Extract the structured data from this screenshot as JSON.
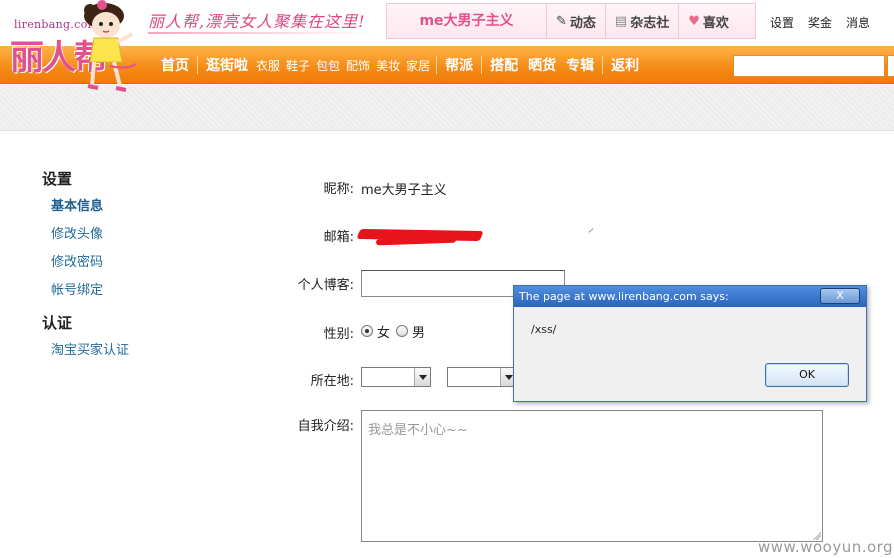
{
  "header": {
    "logo_url": "lirenbang.com",
    "logo_text": "丽人帮",
    "slogan": "丽人帮,漂亮女人聚集在这里!",
    "user_name": "me大男子主义",
    "user_links": [
      {
        "icon": "pencil-icon",
        "label": "动态"
      },
      {
        "icon": "magazine-icon",
        "label": "杂志社"
      },
      {
        "icon": "heart-icon",
        "label": "喜欢"
      }
    ],
    "top_links": [
      "设置",
      "奖金",
      "消息"
    ]
  },
  "nav": {
    "items": [
      {
        "label": "首页",
        "size": "big"
      },
      {
        "sep": true
      },
      {
        "label": "逛街啦",
        "size": "big"
      },
      {
        "label": "衣服",
        "size": "small"
      },
      {
        "label": "鞋子",
        "size": "small"
      },
      {
        "label": "包包",
        "size": "small"
      },
      {
        "label": "配饰",
        "size": "small"
      },
      {
        "label": "美妆",
        "size": "small"
      },
      {
        "label": "家居",
        "size": "small"
      },
      {
        "sep": true
      },
      {
        "label": "帮派",
        "size": "big"
      },
      {
        "sep": true
      },
      {
        "label": "搭配",
        "size": "big"
      },
      {
        "label": "晒货",
        "size": "big"
      },
      {
        "label": "专辑",
        "size": "big"
      },
      {
        "sep": true
      },
      {
        "label": "返利",
        "size": "big"
      }
    ],
    "search_value": ""
  },
  "sidebar": {
    "settings_heading": "设置",
    "settings_items": [
      "基本信息",
      "修改头像",
      "修改密码",
      "帐号绑定"
    ],
    "verify_heading": "认证",
    "verify_items": [
      "淘宝买家认证"
    ]
  },
  "form": {
    "nickname_label": "昵称:",
    "nickname_value": "me大男子主义",
    "email_label": "邮箱:",
    "blog_label": "个人博客:",
    "blog_value": "",
    "gender_label": "性别:",
    "gender_female": "女",
    "gender_male": "男",
    "gender_selected": "女",
    "location_label": "所在地:",
    "bio_label": "自我介绍:",
    "bio_placeholder": "我总是不小心~~"
  },
  "dialog": {
    "title": "The page at www.lirenbang.com says:",
    "close_glyph": "X",
    "message": "/xss/",
    "ok_label": "OK"
  },
  "watermark": "www.wooyun.org",
  "colors": {
    "brand_pink": "#e2508e",
    "nav_orange": "#f58a16",
    "link_blue": "#236a9b",
    "dialog_blue": "#2b64bd"
  }
}
